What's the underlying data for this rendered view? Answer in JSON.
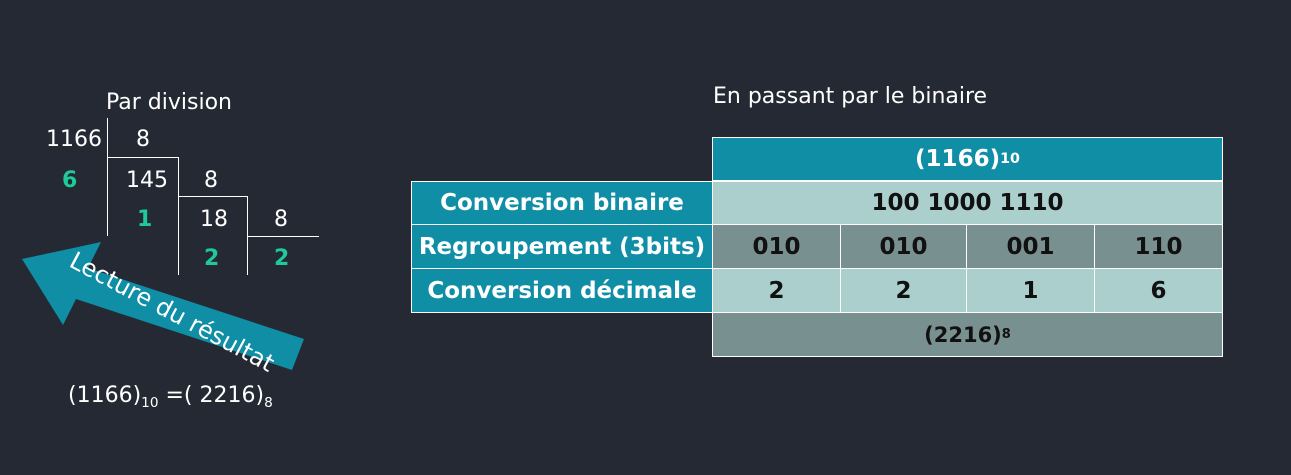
{
  "left": {
    "title": "Par division",
    "numbers": {
      "n1166": "1166",
      "d1": "8",
      "r1": "6",
      "n145": "145",
      "d2": "8",
      "r2": "1",
      "n18": "18",
      "d3": "8",
      "r3": "2",
      "q3": "2"
    },
    "arrow_label": "Lecture du résultat",
    "result": {
      "left_value": "(1166)",
      "left_base": "10",
      "eq": "=( 2216)",
      "right_base": "8"
    }
  },
  "right": {
    "title": "En passant par le binaire",
    "header": {
      "value": "(1166)",
      "base": "10"
    },
    "rows": [
      {
        "label": "Conversion binaire",
        "value": "100 1000 1110"
      },
      {
        "label": "Regroupement (3bits)",
        "groups": [
          "010",
          "010",
          "001",
          "110"
        ]
      },
      {
        "label": "Conversion décimale",
        "digits": [
          "2",
          "2",
          "1",
          "6"
        ]
      }
    ],
    "footer": {
      "value": "(2216)",
      "base": "8"
    }
  },
  "colors": {
    "background": "#242933",
    "teal": "#0f8ea5",
    "light": "#aacfcc",
    "gray": "#78908f",
    "green": "#1fc99a"
  }
}
